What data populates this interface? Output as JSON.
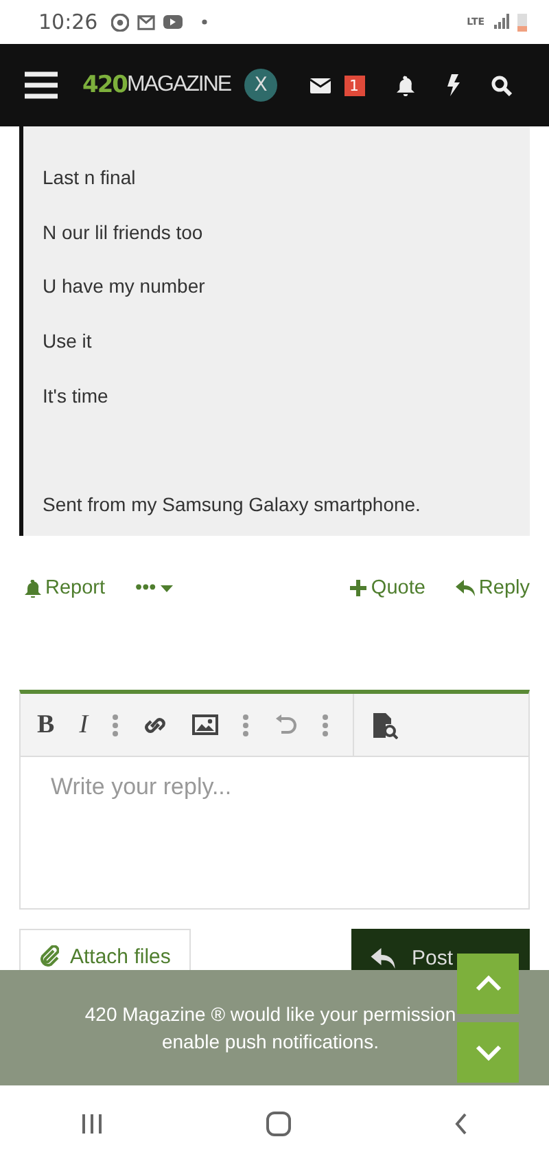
{
  "status_bar": {
    "time": "10:26",
    "network": "LTE"
  },
  "header": {
    "logo_number": "420",
    "logo_word": "MAGAZINE",
    "avatar_letter": "X",
    "inbox_count": "1"
  },
  "quote": {
    "lines": [
      "Last n final",
      "N our lil friends too",
      "U have my number",
      "Use it",
      "It's time"
    ],
    "signature": "Sent from my Samsung Galaxy smartphone."
  },
  "post_actions": {
    "left": [
      {
        "kind": "report",
        "label": "Report"
      },
      {
        "kind": "more",
        "label": "•••"
      }
    ],
    "right": [
      {
        "kind": "quote",
        "label": "Quote"
      },
      {
        "kind": "reply",
        "label": "Reply"
      }
    ]
  },
  "editor": {
    "toolbar": [
      {
        "kind": "bold",
        "label": "B"
      },
      {
        "kind": "italic",
        "label": "I"
      },
      {
        "kind": "dots"
      },
      {
        "kind": "link"
      },
      {
        "kind": "image"
      },
      {
        "kind": "dots"
      },
      {
        "kind": "undo"
      },
      {
        "kind": "dots"
      },
      {
        "kind": "preview"
      }
    ],
    "placeholder": "Write your reply..."
  },
  "buttons": {
    "attach": "Attach files",
    "post": "Post"
  },
  "push_banner": {
    "text": "420 Magazine ® would like your permission",
    "link": "enable push notifications",
    "after_link": "."
  }
}
